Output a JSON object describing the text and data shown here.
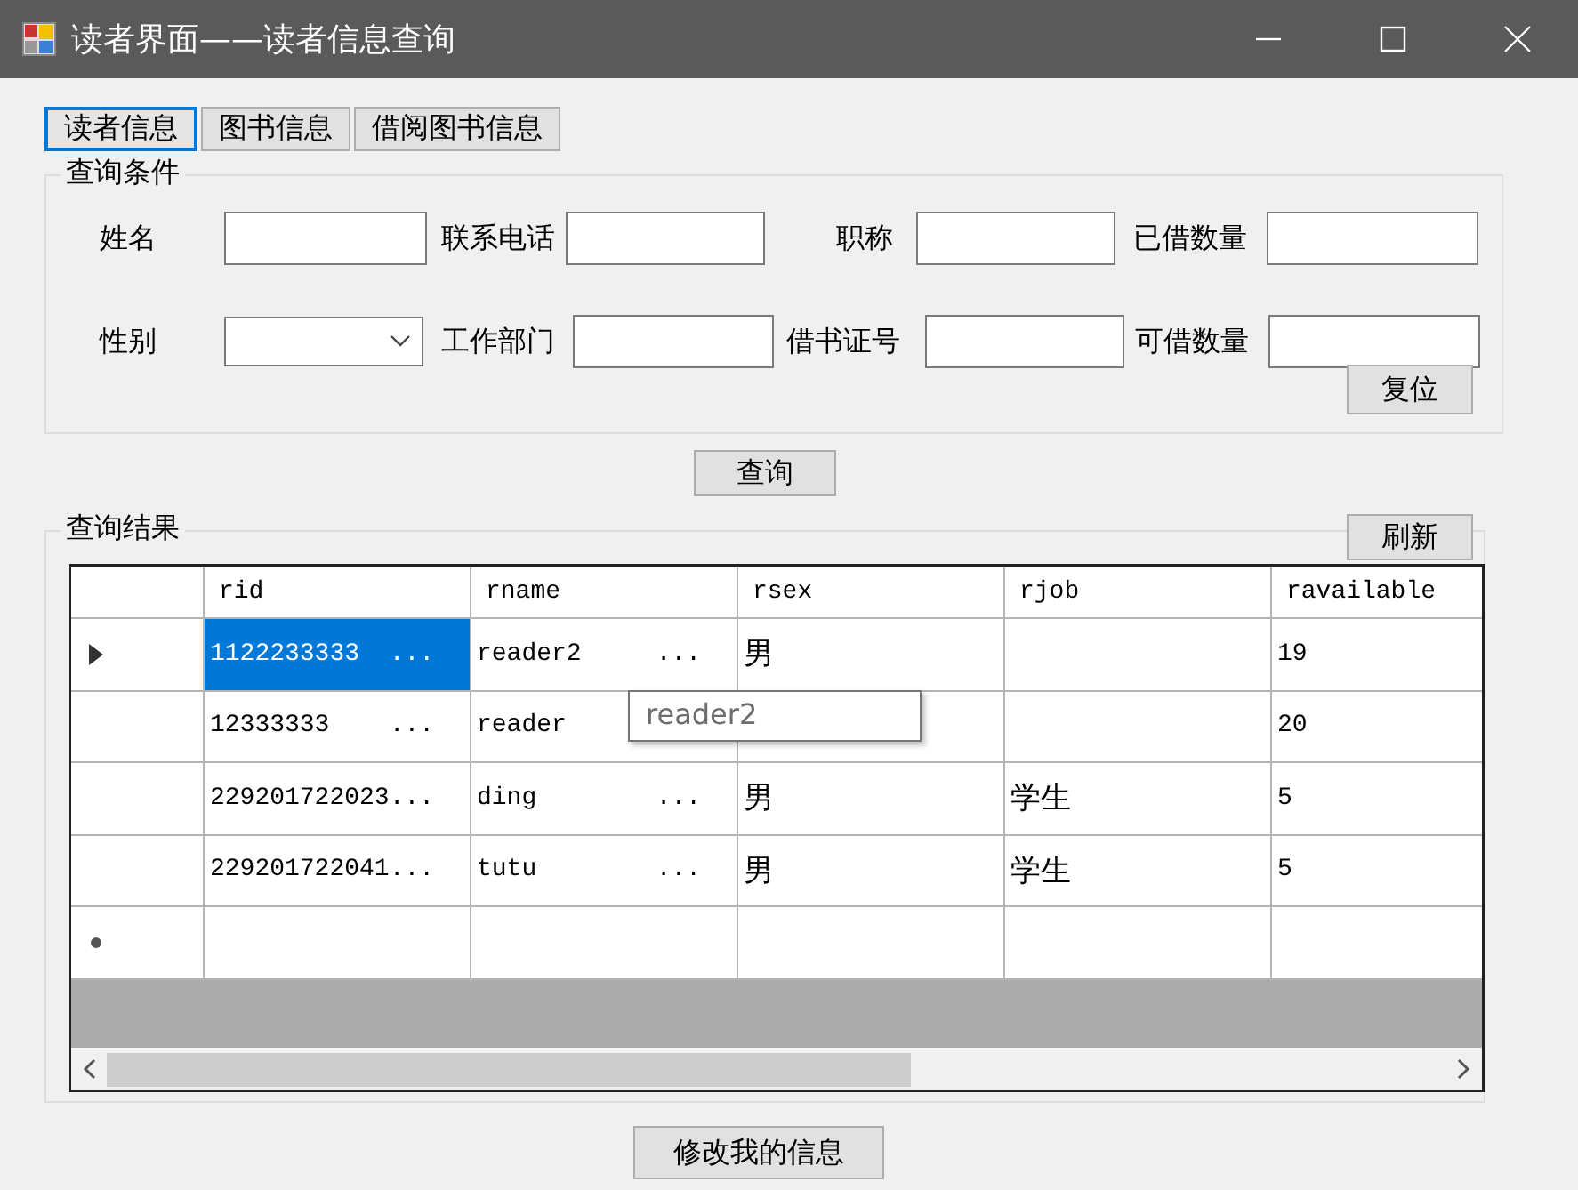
{
  "window": {
    "title": "读者界面——读者信息查询"
  },
  "tabs": [
    {
      "label": "读者信息",
      "selected": true
    },
    {
      "label": "图书信息",
      "selected": false
    },
    {
      "label": "借阅图书信息",
      "selected": false
    }
  ],
  "query_group": {
    "title": "查询条件",
    "fields": [
      {
        "label": "姓名",
        "kind": "text"
      },
      {
        "label": "联系电话",
        "kind": "text"
      },
      {
        "label": "职称",
        "kind": "text"
      },
      {
        "label": "已借数量",
        "kind": "text"
      },
      {
        "label": "性别",
        "kind": "combo"
      },
      {
        "label": "工作部门",
        "kind": "text"
      },
      {
        "label": "借书证号",
        "kind": "text"
      },
      {
        "label": "可借数量",
        "kind": "text"
      }
    ],
    "reset_button": "复位"
  },
  "query_button": "查询",
  "result_group": {
    "title": "查询结果",
    "refresh_button": "刷新",
    "table": {
      "columns": [
        "rid",
        "rname",
        "rsex",
        "rjob",
        "ravailable"
      ],
      "rows": [
        {
          "kind": "data",
          "selected": true,
          "cells": [
            "1122233333  ...",
            "reader2     ...",
            "男",
            null,
            "19"
          ]
        },
        {
          "kind": "data",
          "selected": false,
          "cells": [
            "12333333    ...",
            "reader",
            null,
            null,
            "20"
          ]
        },
        {
          "kind": "data",
          "selected": false,
          "cells": [
            "229201722023...",
            "ding        ...",
            "男",
            "学生",
            "5"
          ]
        },
        {
          "kind": "data",
          "selected": false,
          "cells": [
            "229201722041...",
            "tutu        ...",
            "男",
            "学生",
            "5"
          ]
        },
        {
          "kind": "new",
          "selected": false,
          "cells": [
            null,
            null,
            null,
            null,
            null
          ]
        }
      ]
    },
    "tooltip": "reader2"
  },
  "bottom_button": "修改我的信息"
}
